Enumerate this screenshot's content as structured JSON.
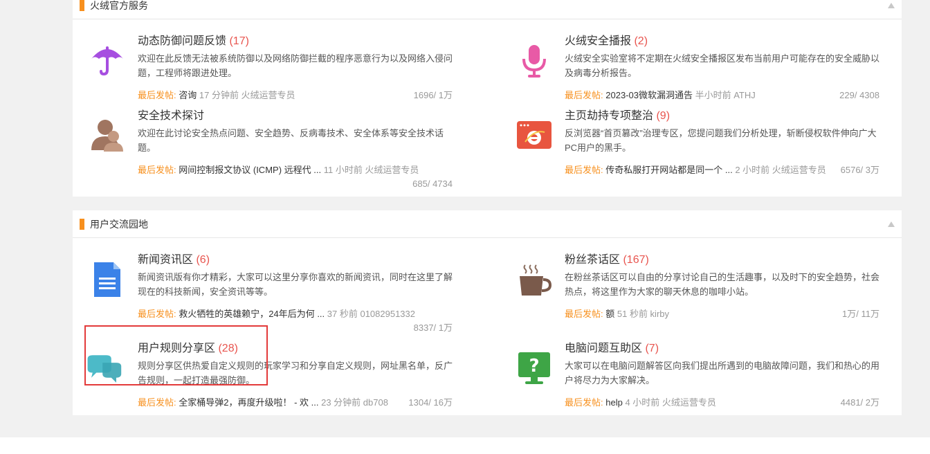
{
  "sections": [
    {
      "title": "火绒官方服务",
      "forums": [
        {
          "title": "动态防御问题反馈",
          "count": "(17)",
          "icon": "umbrella-icon",
          "desc": "欢迎在此反馈无法被系统防御以及网络防御拦截的程序恶意行为以及网络入侵问题，工程师将跟进处理。",
          "last_label": "最后发帖:",
          "last_title": "咨询",
          "last_meta": " 17 分钟前 火绒运营专员",
          "stats": "1696/ 1万"
        },
        {
          "title": "火绒安全播报",
          "count": "(2)",
          "icon": "microphone-icon",
          "desc": "火绒安全实验室将不定期在火绒安全播报区发布当前用户可能存在的安全威胁以及病毒分析报告。",
          "last_label": "最后发帖:",
          "last_title": "2023-03微软漏洞通告",
          "last_meta": " 半小时前 ATHJ",
          "stats": "229/ 4308"
        },
        {
          "title": "安全技术探讨",
          "count": "",
          "icon": "users-icon",
          "desc": "欢迎在此讨论安全热点问题、安全趋势、反病毒技术、安全体系等安全技术话题。",
          "last_label": "最后发帖:",
          "last_title": "网间控制报文协议 (ICMP) 远程代 ...",
          "last_meta": " 11 小时前 火绒运营专员",
          "stats": "685/ 4734"
        },
        {
          "title": "主页劫持专项整治",
          "count": "(9)",
          "icon": "browser-icon",
          "desc": "反浏览器“首页篡改”治理专区，您提问题我们分析处理，斩断侵权软件伸向广大PC用户的黑手。",
          "last_label": "最后发帖:",
          "last_title": "传奇私服打开网站都是同一个 ...",
          "last_meta": " 2 小时前 火绒运营专员",
          "stats": "6576/ 3万"
        }
      ]
    },
    {
      "title": "用户交流园地",
      "forums": [
        {
          "title": "新闻资讯区",
          "count": "(6)",
          "icon": "document-icon",
          "desc": "新闻资讯版有你才精彩，大家可以这里分享你喜欢的新闻资讯，同时在这里了解现在的科技新闻，安全资讯等等。",
          "last_label": "最后发帖:",
          "last_title": "救火牺牲的英雄赖宁，24年后为何 ...",
          "last_meta": " 37 秒前 01082951332",
          "stats": "8337/ 1万"
        },
        {
          "title": "粉丝茶话区",
          "count": "(167)",
          "icon": "coffee-cup-icon",
          "desc": "在粉丝茶话区可以自由的分享讨论自己的生活趣事，以及时下的安全趋势，社会热点，将这里作为大家的聊天休息的咖啡小站。",
          "last_label": "最后发帖:",
          "last_title": "额",
          "last_meta": " 51 秒前 kirby",
          "stats": "1万/ 11万"
        },
        {
          "title": "用户规则分享区",
          "count": "(28)",
          "icon": "chat-bubbles-icon",
          "desc": "规则分享区供热爱自定义规则的玩家学习和分享自定义规则，网址黑名单，反广告规则，一起打造最强防御。",
          "last_label": "最后发帖:",
          "last_title": "全家桶导弹2，再度升级啦！ - 欢 ...",
          "last_meta": " 23 分钟前 db708",
          "stats": "1304/ 16万"
        },
        {
          "title": "电脑问题互助区",
          "count": "(7)",
          "icon": "help-monitor-icon",
          "desc": "大家可以在电脑问题解答区向我们提出所遇到的电脑故障问题，我们和热心的用户将尽力为大家解决。",
          "last_label": "最后发帖:",
          "last_title": "help",
          "last_meta": " 4 小时前 火绒运营专员",
          "stats": "4481/ 2万"
        }
      ]
    }
  ],
  "colors": {
    "accent": "#f7901e",
    "count": "#e8544e",
    "highlight": "#e33a3a"
  }
}
